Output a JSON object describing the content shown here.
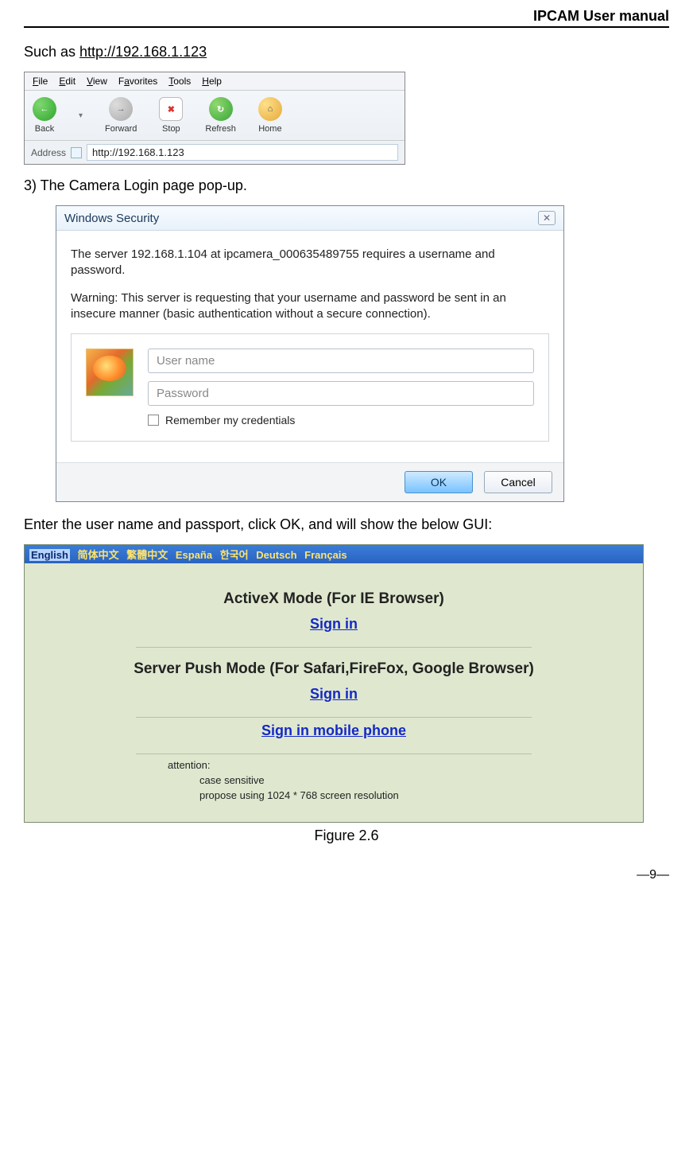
{
  "header": {
    "title": "IPCAM User manual"
  },
  "intro": {
    "prefix": "Such as ",
    "url": "http://192.168.1.123"
  },
  "browser": {
    "menus": {
      "file": "File",
      "edit": "Edit",
      "view": "View",
      "favorites": "Favorites",
      "tools": "Tools",
      "help": "Help"
    },
    "buttons": {
      "back": "Back",
      "forward": "Forward",
      "stop": "Stop",
      "refresh": "Refresh",
      "home": "Home"
    },
    "address_label": "Address",
    "address_value": "http://192.168.1.123"
  },
  "step3": "3)  The Camera Login page pop-up.",
  "dialog": {
    "title": "Windows Security",
    "line1": "The server 192.168.1.104 at ipcamera_000635489755 requires a username and password.",
    "line2": "Warning: This server is requesting that your username and password be sent in an insecure manner (basic authentication without a secure connection).",
    "username_ph": "User name",
    "password_ph": "Password",
    "remember": "Remember my credentials",
    "ok": "OK",
    "cancel": "Cancel"
  },
  "after_dialog": "Enter the user name and passport, click OK, and will show the below GUI:",
  "gui": {
    "langs": {
      "english": "English",
      "zh_s": "简体中文",
      "zh_t": "繁體中文",
      "es": "España",
      "ko": "한국어",
      "de": "Deutsch",
      "fr": "Français"
    },
    "mode1_title": "ActiveX Mode (For IE Browser)",
    "signin": "Sign in",
    "mode2_title": "Server Push Mode (For Safari,FireFox, Google Browser)",
    "mobile": "Sign in mobile phone",
    "attention_label": "attention:",
    "att1": "case sensitive",
    "att2": "propose using 1024 * 768 screen resolution"
  },
  "caption": "Figure 2.6",
  "pagenum": "—9—"
}
